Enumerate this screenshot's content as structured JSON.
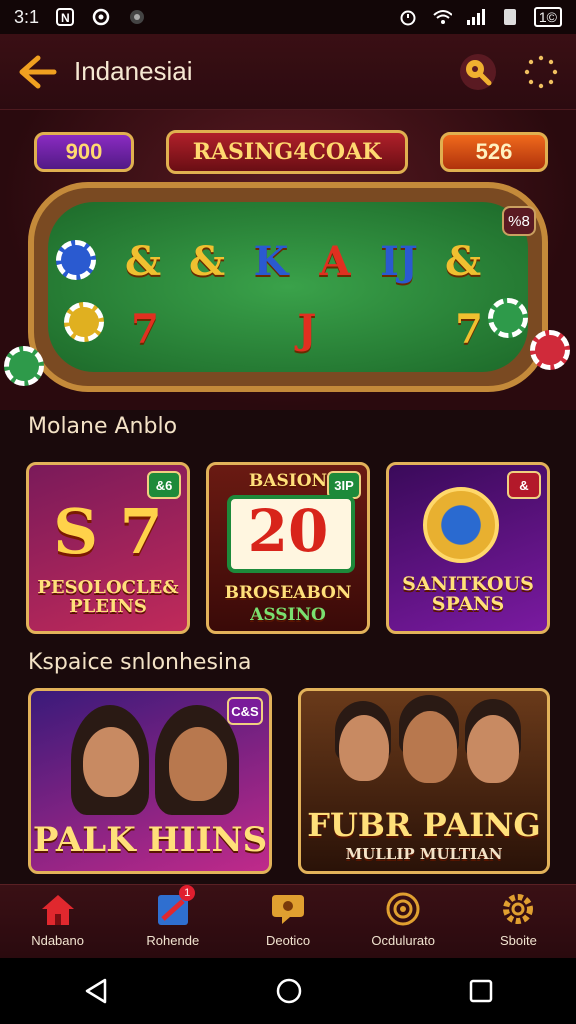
{
  "status_bar": {
    "time": "3:1",
    "battery": "1©"
  },
  "app_bar": {
    "title": "Indanesiai"
  },
  "hero": {
    "left_pill": "900",
    "center_pill": "RASING4COAK",
    "right_pill": "526",
    "table_badge": "%8",
    "cards_row1": [
      "&",
      "&",
      "K",
      "A",
      "IJ",
      "&"
    ],
    "cards_row2": [
      "7",
      "J",
      "7"
    ]
  },
  "section1": {
    "title": "Molane Anblo",
    "games": [
      {
        "big": "S 7",
        "caption": "PESOLOCLE&\nPLEINS",
        "badge": "&6"
      },
      {
        "top": "BASION",
        "big": "20",
        "caption": "BROSEABON",
        "subcaption": "ASSINO",
        "badge": "3IP"
      },
      {
        "big": "",
        "caption": "SANITKOUS\nSPANS",
        "badge": "&"
      }
    ]
  },
  "section2": {
    "title": "Kspaice snlonhesina",
    "games": [
      {
        "caption": "PALK HIINS",
        "badge": "C&S"
      },
      {
        "caption": "FUBR PAING",
        "subcaption": "MULLIP MULTIAN"
      }
    ]
  },
  "bottom_nav": {
    "items": [
      {
        "label": "Ndabano",
        "icon": "home-icon"
      },
      {
        "label": "Rohende",
        "icon": "grid-icon",
        "badge": "1"
      },
      {
        "label": "Deotico",
        "icon": "chat-icon"
      },
      {
        "label": "Ocdulurato",
        "icon": "target-icon"
      },
      {
        "label": "Sboite",
        "icon": "gear-icon"
      }
    ]
  },
  "colors": {
    "accent_gold": "#e2b25a",
    "app_bg": "#2c0b10",
    "felt_green": "#2f8c3d",
    "home_red": "#e0282e",
    "grid_blue": "#2f6fd0"
  }
}
